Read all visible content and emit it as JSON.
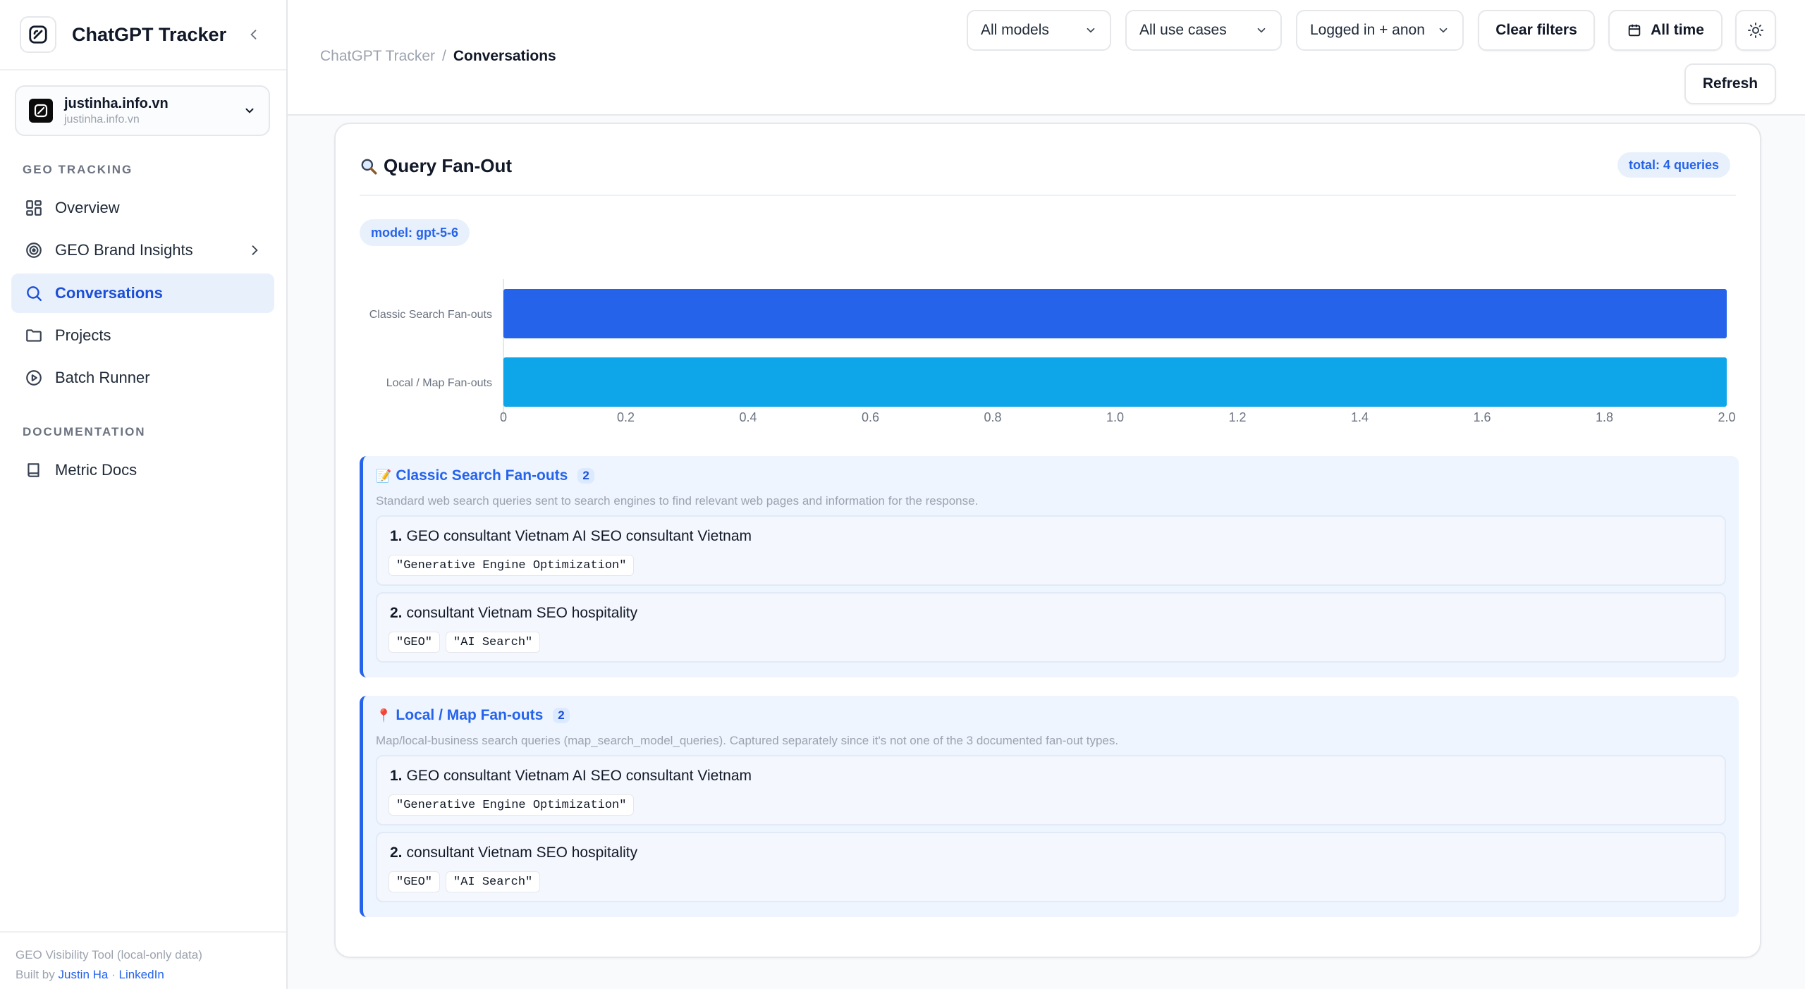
{
  "app": {
    "title": "ChatGPT Tracker"
  },
  "site": {
    "name": "justinha.info.vn",
    "sub": "justinha.info.vn"
  },
  "sidebar": {
    "sections": [
      {
        "label": "GEO TRACKING"
      },
      {
        "label": "DOCUMENTATION"
      }
    ],
    "items": [
      {
        "label": "Overview",
        "icon": "grid-icon"
      },
      {
        "label": "GEO Brand Insights",
        "icon": "target-icon"
      },
      {
        "label": "Conversations",
        "icon": "search-icon",
        "active": true
      },
      {
        "label": "Projects",
        "icon": "folder-icon"
      },
      {
        "label": "Batch Runner",
        "icon": "play-circle-icon"
      },
      {
        "label": "Metric Docs",
        "icon": "book-icon"
      }
    ],
    "footer": {
      "line1": "GEO Visibility Tool (local-only data)",
      "built_by": "Built by",
      "author": "Justin Ha",
      "dot": "·",
      "link": "LinkedIn"
    }
  },
  "breadcrumb": {
    "root": "ChatGPT Tracker",
    "sep": "/",
    "current": "Conversations"
  },
  "filters": {
    "models": "All models",
    "use_cases": "All use cases",
    "login": "Logged in + anon"
  },
  "toolbar": {
    "clear": "Clear filters",
    "time": "All time",
    "refresh": "Refresh"
  },
  "card": {
    "title": "Query Fan-Out",
    "total": "total: 4 queries",
    "model": "model: gpt-5-6"
  },
  "chart_data": {
    "type": "bar",
    "orientation": "horizontal",
    "categories": [
      "Classic Search Fan-outs",
      "Local / Map Fan-outs"
    ],
    "values": [
      2,
      2
    ],
    "colors": [
      "#2563eb",
      "#0ea5e9"
    ],
    "xlim": [
      0,
      2.0
    ],
    "xticks": [
      "0",
      "0.2",
      "0.4",
      "0.6",
      "0.8",
      "1.0",
      "1.2",
      "1.4",
      "1.6",
      "1.8",
      "2.0"
    ]
  },
  "groups": [
    {
      "emoji": "📝",
      "title": "Classic Search Fan-outs",
      "count": "2",
      "desc": "Standard web search queries sent to search engines to find relevant web pages and information for the response.",
      "queries": [
        {
          "num": "1.",
          "text": "GEO consultant Vietnam AI SEO consultant Vietnam",
          "tags": [
            "\"Generative Engine Optimization\""
          ]
        },
        {
          "num": "2.",
          "text": "consultant Vietnam SEO hospitality",
          "tags": [
            "\"GEO\"",
            "\"AI Search\""
          ]
        }
      ]
    },
    {
      "emoji": "📍",
      "title": "Local / Map Fan-outs",
      "count": "2",
      "desc": "Map/local-business search queries (map_search_model_queries). Captured separately since it's not one of the 3 documented fan-out types.",
      "queries": [
        {
          "num": "1.",
          "text": "GEO consultant Vietnam AI SEO consultant Vietnam",
          "tags": [
            "\"Generative Engine Optimization\""
          ]
        },
        {
          "num": "2.",
          "text": "consultant Vietnam SEO hospitality",
          "tags": [
            "\"GEO\"",
            "\"AI Search\""
          ]
        }
      ]
    }
  ]
}
